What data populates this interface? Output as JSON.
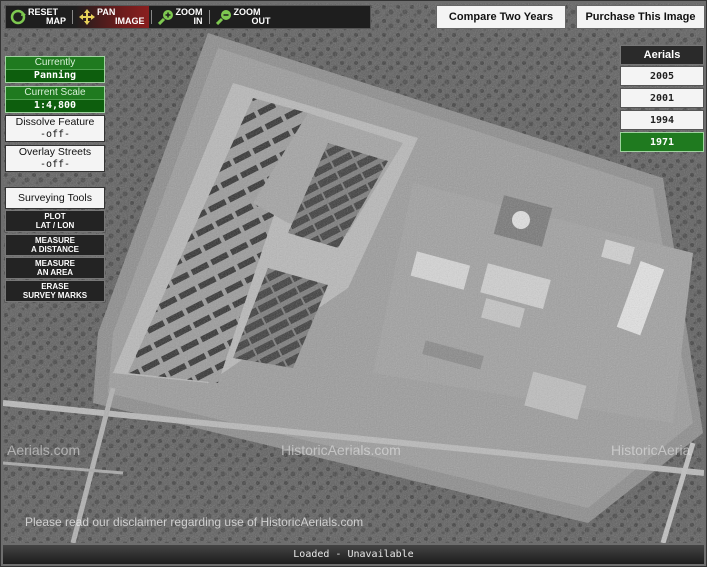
{
  "toolbar": {
    "reset": {
      "line1": "RESET",
      "line2": "MAP"
    },
    "pan": {
      "line1": "PAN",
      "line2": "IMAGE"
    },
    "zoom_in": {
      "line1": "ZOOM",
      "line2": "IN"
    },
    "zoom_out": {
      "line1": "ZOOM",
      "line2": "OUT"
    }
  },
  "top_buttons": {
    "compare": "Compare Two Years",
    "purchase": "Purchase This Image"
  },
  "left_panel": {
    "currently_label": "Currently",
    "currently_value": "Panning",
    "scale_label": "Current Scale",
    "scale_value": "1:4,800",
    "dissolve_label": "Dissolve Feature",
    "dissolve_value": "-off-",
    "overlay_label": "Overlay Streets",
    "overlay_value": "-off-"
  },
  "surveying": {
    "title": "Surveying Tools",
    "plot": {
      "line1": "PLOT",
      "line2": "LAT / LON"
    },
    "measure_distance": {
      "line1": "MEASURE",
      "line2": "A DISTANCE"
    },
    "measure_area": {
      "line1": "MEASURE",
      "line2": "AN AREA"
    },
    "erase": {
      "line1": "ERASE",
      "line2": "SURVEY MARKS"
    }
  },
  "aerials": {
    "title": "Aerials",
    "years": [
      "2005",
      "2001",
      "1994",
      "1971"
    ],
    "selected": "1971"
  },
  "watermarks": [
    "Aerials.com",
    "HistoricAerials.com",
    "HistoricAeria"
  ],
  "disclaimer": "Please read our disclaimer regarding use of HistoricAerials.com",
  "status": "Loaded - Unavailable",
  "colors": {
    "active_green": "#1f7a1f",
    "toolbar_dark": "#1e1e1e",
    "pan_active": "#8a1f1f"
  },
  "icons": [
    "reset-icon",
    "pan-icon",
    "zoom-in-icon",
    "zoom-out-icon"
  ]
}
